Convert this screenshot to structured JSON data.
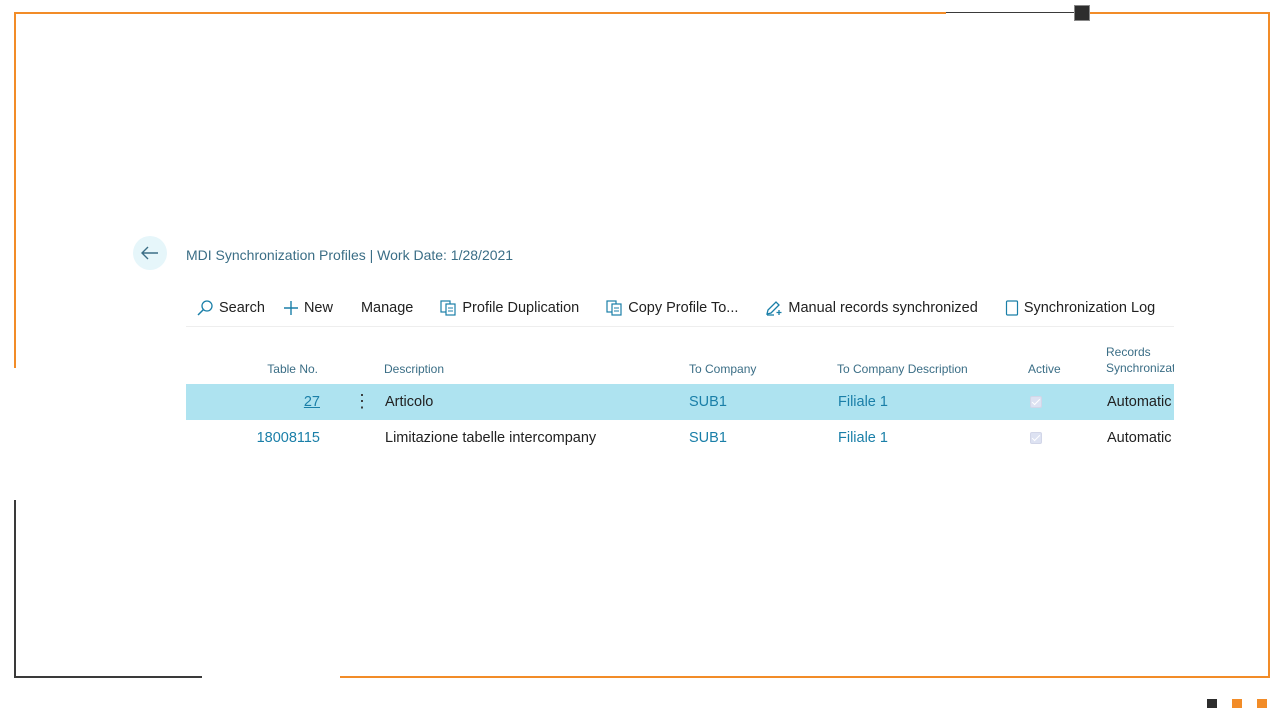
{
  "page": {
    "title": "MDI Synchronization Profiles | Work Date: 1/28/2021"
  },
  "actions": {
    "search": "Search",
    "new": "New",
    "manage": "Manage",
    "profile_duplication": "Profile Duplication",
    "copy_profile_to": "Copy Profile To...",
    "manual_records": "Manual records synchronized",
    "sync_log": "Synchronization Log"
  },
  "columns": {
    "table_no": "Table No.",
    "description": "Description",
    "to_company": "To Company",
    "to_company_description": "To Company Description",
    "active": "Active",
    "records_sync_1": "Records",
    "records_sync_2": "Synchronizat"
  },
  "rows": [
    {
      "table_no": "27",
      "description": "Articolo",
      "to_company": "SUB1",
      "to_company_description": "Filiale 1",
      "active": true,
      "records_sync": "Automatic"
    },
    {
      "table_no": "18008115",
      "description": "Limitazione tabelle intercompany",
      "to_company": "SUB1",
      "to_company_description": "Filiale 1",
      "active": true,
      "records_sync": "Automatic"
    }
  ],
  "colors": {
    "frame_accent": "#f28c28",
    "frame_dark": "#3a3a3a",
    "selected_row": "#aee3f0",
    "link": "#1a7fa8",
    "header_text": "#3b6e86"
  }
}
